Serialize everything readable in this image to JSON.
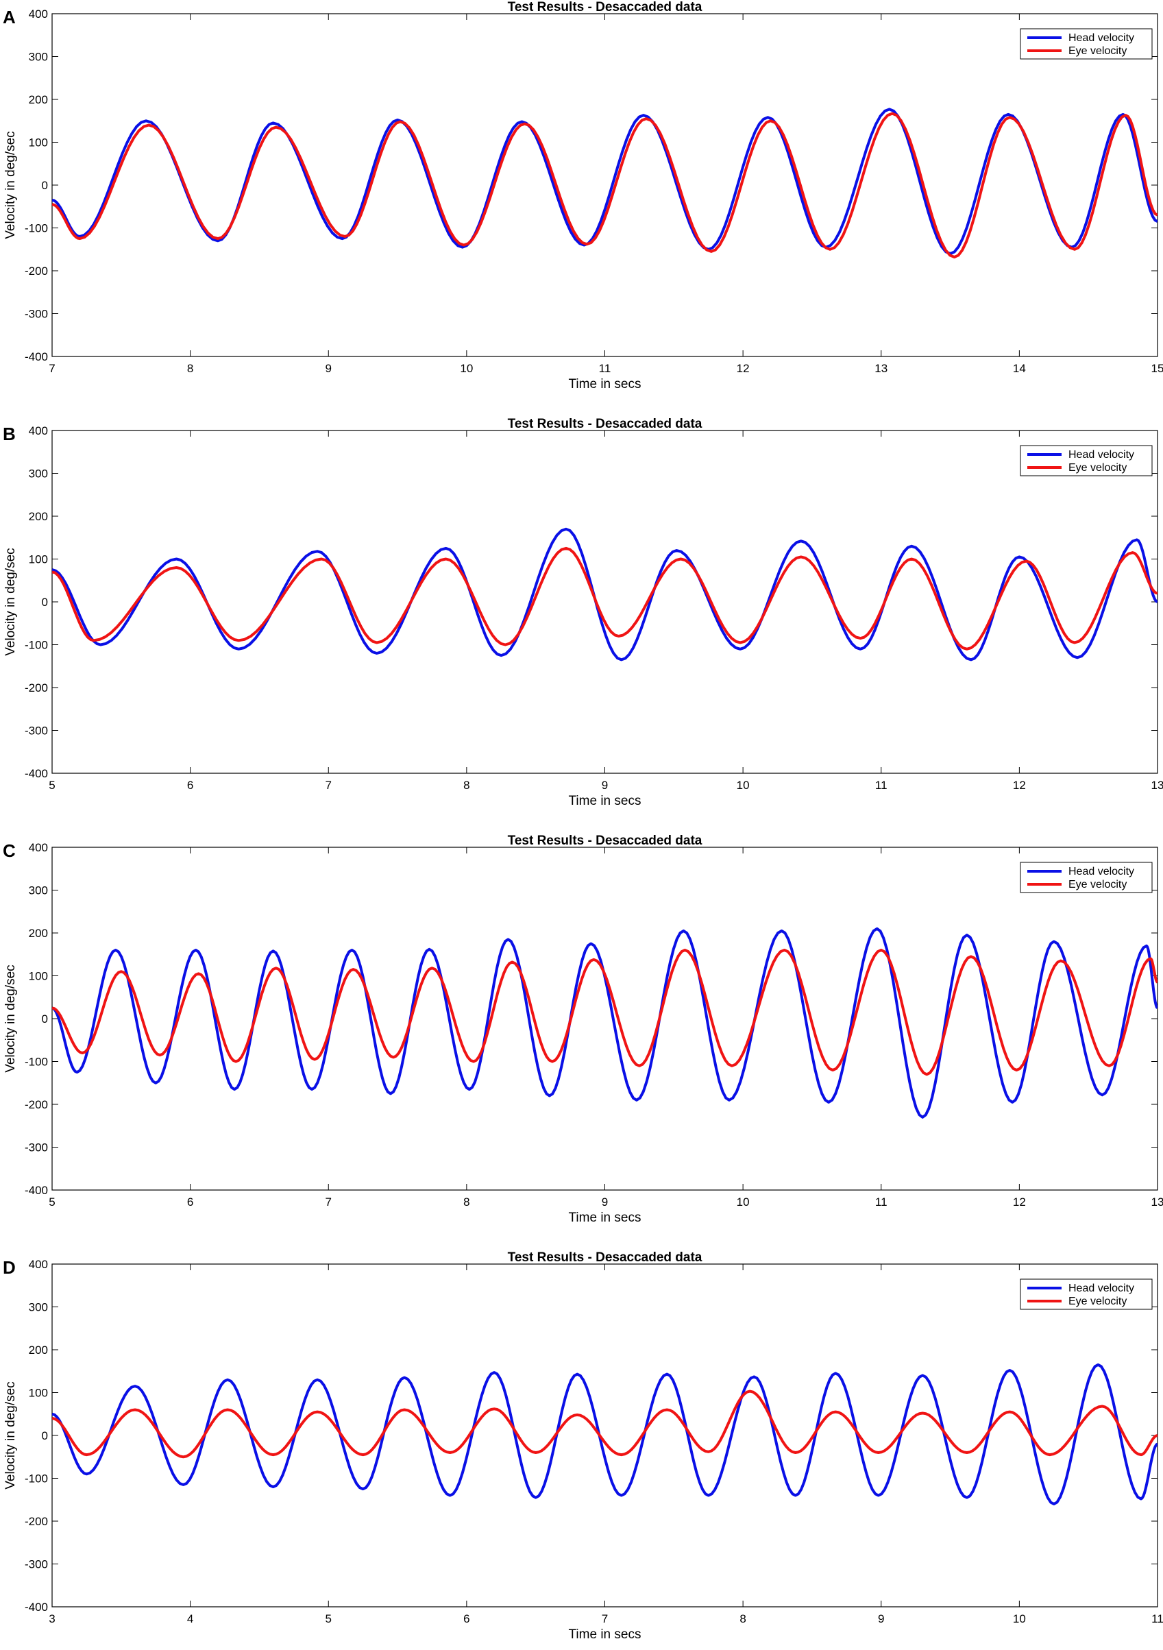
{
  "colors": {
    "head": "#0a10e6",
    "eye": "#f01414",
    "axis": "#000000"
  },
  "chart_data": [
    {
      "type": "line",
      "panel_label": "A",
      "title": "Test Results - Desaccaded data",
      "xlabel": "Time in secs",
      "ylabel": "Velocity in deg/sec",
      "xlim": [
        7,
        15
      ],
      "ylim": [
        -400,
        400
      ],
      "xticks": [
        7,
        8,
        9,
        10,
        11,
        12,
        13,
        14,
        15
      ],
      "yticks": [
        -400,
        -300,
        -200,
        -100,
        0,
        100,
        200,
        300,
        400
      ],
      "legend": {
        "position": "top-right",
        "entries": [
          "Head velocity",
          "Eye velocity"
        ]
      },
      "grid": false,
      "series": [
        {
          "name": "Head velocity",
          "x": [
            7.0,
            7.2,
            7.68,
            8.2,
            8.6,
            9.1,
            9.5,
            9.97,
            10.4,
            10.85,
            11.28,
            11.75,
            12.18,
            12.6,
            13.06,
            13.5,
            13.92,
            14.38,
            14.75,
            15.0
          ],
          "y": [
            -35,
            -120,
            150,
            -130,
            145,
            -125,
            152,
            -145,
            148,
            -140,
            163,
            -150,
            158,
            -145,
            177,
            -160,
            165,
            -145,
            165,
            -85
          ]
        },
        {
          "name": "Eye velocity",
          "x": [
            7.0,
            7.2,
            7.7,
            8.2,
            8.62,
            9.12,
            9.52,
            9.98,
            10.42,
            10.87,
            11.3,
            11.77,
            12.2,
            12.63,
            13.08,
            13.53,
            13.93,
            14.4,
            14.77,
            15.0
          ],
          "y": [
            -45,
            -125,
            140,
            -125,
            135,
            -120,
            148,
            -140,
            143,
            -138,
            155,
            -155,
            150,
            -150,
            167,
            -168,
            158,
            -150,
            163,
            -70
          ]
        }
      ]
    },
    {
      "type": "line",
      "panel_label": "B",
      "title": "Test Results - Desaccaded data",
      "xlabel": "Time in secs",
      "ylabel": "Velocity in deg/sec",
      "xlim": [
        5,
        13
      ],
      "ylim": [
        -400,
        400
      ],
      "xticks": [
        5,
        6,
        7,
        8,
        9,
        10,
        11,
        12,
        13
      ],
      "yticks": [
        -400,
        -300,
        -200,
        -100,
        0,
        100,
        200,
        300,
        400
      ],
      "legend": {
        "position": "top-right",
        "entries": [
          "Head velocity",
          "Eye velocity"
        ]
      },
      "grid": false,
      "series": [
        {
          "name": "Head velocity",
          "x": [
            5.0,
            5.35,
            5.9,
            6.35,
            6.92,
            7.35,
            7.85,
            8.25,
            8.72,
            9.12,
            9.52,
            9.98,
            10.42,
            10.85,
            11.22,
            11.65,
            12.0,
            12.42,
            12.85,
            13.0
          ],
          "y": [
            75,
            -100,
            100,
            -110,
            118,
            -120,
            125,
            -125,
            170,
            -135,
            120,
            -110,
            142,
            -110,
            130,
            -135,
            105,
            -130,
            145,
            0
          ]
        },
        {
          "name": "Eye velocity",
          "x": [
            5.0,
            5.3,
            5.9,
            6.35,
            6.95,
            7.35,
            7.85,
            8.28,
            8.72,
            9.1,
            9.55,
            9.98,
            10.42,
            10.85,
            11.22,
            11.62,
            12.05,
            12.4,
            12.82,
            13.0
          ],
          "y": [
            70,
            -90,
            80,
            -90,
            100,
            -95,
            100,
            -100,
            125,
            -80,
            100,
            -95,
            105,
            -85,
            100,
            -110,
            95,
            -95,
            115,
            20
          ]
        }
      ]
    },
    {
      "type": "line",
      "panel_label": "C",
      "title": "Test Results - Desaccaded data",
      "xlabel": "Time in secs",
      "ylabel": "Velocity in deg/sec",
      "xlim": [
        5,
        13
      ],
      "ylim": [
        -400,
        400
      ],
      "xticks": [
        5,
        6,
        7,
        8,
        9,
        10,
        11,
        12,
        13
      ],
      "yticks": [
        -400,
        -300,
        -200,
        -100,
        0,
        100,
        200,
        300,
        400
      ],
      "legend": {
        "position": "top-right",
        "entries": [
          "Head velocity",
          "Eye velocity"
        ]
      },
      "grid": false,
      "series": [
        {
          "name": "Head velocity",
          "x": [
            5.0,
            5.18,
            5.46,
            5.75,
            6.04,
            6.32,
            6.6,
            6.88,
            7.17,
            7.45,
            7.73,
            8.02,
            8.3,
            8.6,
            8.9,
            9.23,
            9.57,
            9.9,
            10.28,
            10.62,
            10.97,
            11.3,
            11.62,
            11.95,
            12.25,
            12.6,
            12.92,
            13.0
          ],
          "y": [
            25,
            -125,
            160,
            -150,
            160,
            -165,
            158,
            -165,
            160,
            -175,
            162,
            -165,
            185,
            -180,
            175,
            -190,
            205,
            -190,
            205,
            -195,
            210,
            -230,
            195,
            -195,
            180,
            -178,
            170,
            25
          ]
        },
        {
          "name": "Eye velocity",
          "x": [
            5.0,
            5.22,
            5.5,
            5.78,
            6.06,
            6.33,
            6.62,
            6.9,
            7.18,
            7.47,
            7.75,
            8.05,
            8.33,
            8.62,
            8.92,
            9.25,
            9.58,
            9.92,
            10.3,
            10.65,
            11.0,
            11.33,
            11.65,
            11.98,
            12.3,
            12.65,
            12.95,
            13.0
          ],
          "y": [
            25,
            -80,
            110,
            -85,
            105,
            -100,
            118,
            -95,
            115,
            -90,
            118,
            -100,
            132,
            -100,
            138,
            -110,
            160,
            -110,
            160,
            -120,
            160,
            -130,
            145,
            -120,
            135,
            -110,
            140,
            85
          ]
        }
      ]
    },
    {
      "type": "line",
      "panel_label": "D",
      "title": "Test Results - Desaccaded data",
      "xlabel": "Time in secs",
      "ylabel": "Velocity in deg/sec",
      "xlim": [
        3,
        11
      ],
      "ylim": [
        -400,
        400
      ],
      "xticks": [
        3,
        4,
        5,
        6,
        7,
        8,
        9,
        10,
        11
      ],
      "yticks": [
        -400,
        -300,
        -200,
        -100,
        0,
        100,
        200,
        300,
        400
      ],
      "legend": {
        "position": "top-right",
        "entries": [
          "Head velocity",
          "Eye velocity"
        ]
      },
      "grid": false,
      "series": [
        {
          "name": "Head velocity",
          "x": [
            3.0,
            3.25,
            3.6,
            3.95,
            4.27,
            4.6,
            4.92,
            5.25,
            5.55,
            5.88,
            6.2,
            6.5,
            6.8,
            7.12,
            7.45,
            7.75,
            8.08,
            8.38,
            8.67,
            8.98,
            9.3,
            9.62,
            9.93,
            10.25,
            10.57,
            10.88,
            11.0
          ],
          "y": [
            50,
            -90,
            115,
            -115,
            130,
            -120,
            130,
            -125,
            135,
            -140,
            147,
            -145,
            143,
            -140,
            143,
            -140,
            137,
            -140,
            145,
            -140,
            140,
            -145,
            152,
            -160,
            165,
            -148,
            -20
          ]
        },
        {
          "name": "Eye velocity",
          "x": [
            3.0,
            3.25,
            3.6,
            3.95,
            4.27,
            4.6,
            4.92,
            5.25,
            5.55,
            5.88,
            6.2,
            6.5,
            6.8,
            7.12,
            7.45,
            7.75,
            8.05,
            8.38,
            8.67,
            8.98,
            9.3,
            9.62,
            9.93,
            10.22,
            10.6,
            10.88,
            11.0
          ],
          "y": [
            40,
            -45,
            60,
            -50,
            60,
            -45,
            55,
            -45,
            60,
            -40,
            62,
            -40,
            48,
            -45,
            60,
            -38,
            103,
            -40,
            55,
            -40,
            52,
            -40,
            55,
            -45,
            68,
            -45,
            0
          ]
        }
      ]
    }
  ]
}
